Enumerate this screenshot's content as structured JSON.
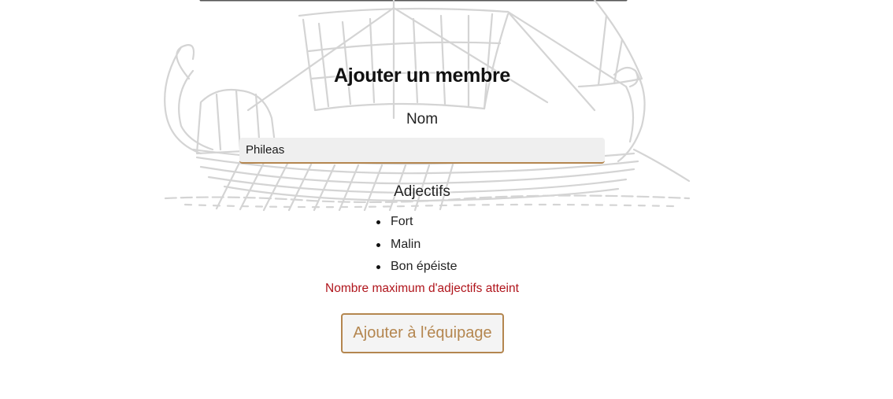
{
  "form": {
    "title": "Ajouter un membre",
    "name_label": "Nom",
    "name_value": "Phileas",
    "adjectives_label": "Adjectifs",
    "adjectives": [
      {
        "label": "Fort"
      },
      {
        "label": "Malin"
      },
      {
        "label": "Bon épéiste"
      }
    ],
    "error_message": "Nombre maximum d'adjectifs atteint",
    "submit_label": "Ajouter à l'équipage"
  },
  "colors": {
    "accent": "#b4864f",
    "error": "#b0151c",
    "input_background": "#efefef",
    "ship_sketch": "#d2d2d2"
  },
  "background": {
    "icon": "viking-ship-sketch"
  }
}
